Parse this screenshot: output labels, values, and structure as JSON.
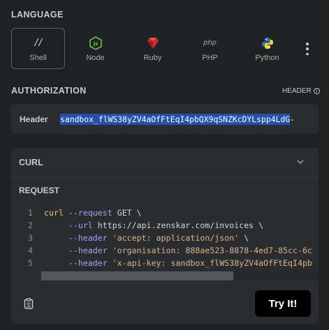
{
  "language": {
    "title": "LANGUAGE",
    "options": [
      {
        "label": "Shell",
        "icon": "shell-icon",
        "active": true
      },
      {
        "label": "Node",
        "icon": "node-icon",
        "active": false
      },
      {
        "label": "Ruby",
        "icon": "ruby-icon",
        "active": false
      },
      {
        "label": "PHP",
        "icon": "php-icon",
        "active": false
      },
      {
        "label": "Python",
        "icon": "python-icon",
        "active": false
      }
    ],
    "shell_glyph": "//",
    "php_glyph": "php"
  },
  "authorization": {
    "title": "AUTHORIZATION",
    "header_link": "HEADER",
    "header_label": "Header",
    "header_value": "sandbox_flWS38yZV4aOfFtEqI4pbQX9qSNZKcDYLspp4LdG",
    "header_value_tail": "-"
  },
  "curl": {
    "title": "CURL",
    "request_title": "REQUEST",
    "lines": [
      {
        "num": "1",
        "parts": [
          {
            "t": "curl",
            "c": "kw"
          },
          {
            "t": " --request",
            "c": "flag"
          },
          {
            "t": " GET \\",
            "c": ""
          }
        ]
      },
      {
        "num": "2",
        "parts": [
          {
            "t": "     --url",
            "c": "flag"
          },
          {
            "t": " https://api.zenskar.com/invoices \\",
            "c": ""
          }
        ]
      },
      {
        "num": "3",
        "parts": [
          {
            "t": "     --header",
            "c": "flag"
          },
          {
            "t": " 'accept: application/json'",
            "c": "str"
          },
          {
            "t": " \\",
            "c": ""
          }
        ]
      },
      {
        "num": "4",
        "parts": [
          {
            "t": "     --header",
            "c": "flag"
          },
          {
            "t": " 'organisation: 888ae523-8878-4ed7-85cc-6c",
            "c": "str"
          }
        ]
      },
      {
        "num": "5",
        "parts": [
          {
            "t": "     --header",
            "c": "flag"
          },
          {
            "t": " 'x-api-key: sandbox_flWS38yZV4aOfFtEqI4pb",
            "c": "str"
          }
        ]
      }
    ],
    "try_label": "Try It!"
  }
}
